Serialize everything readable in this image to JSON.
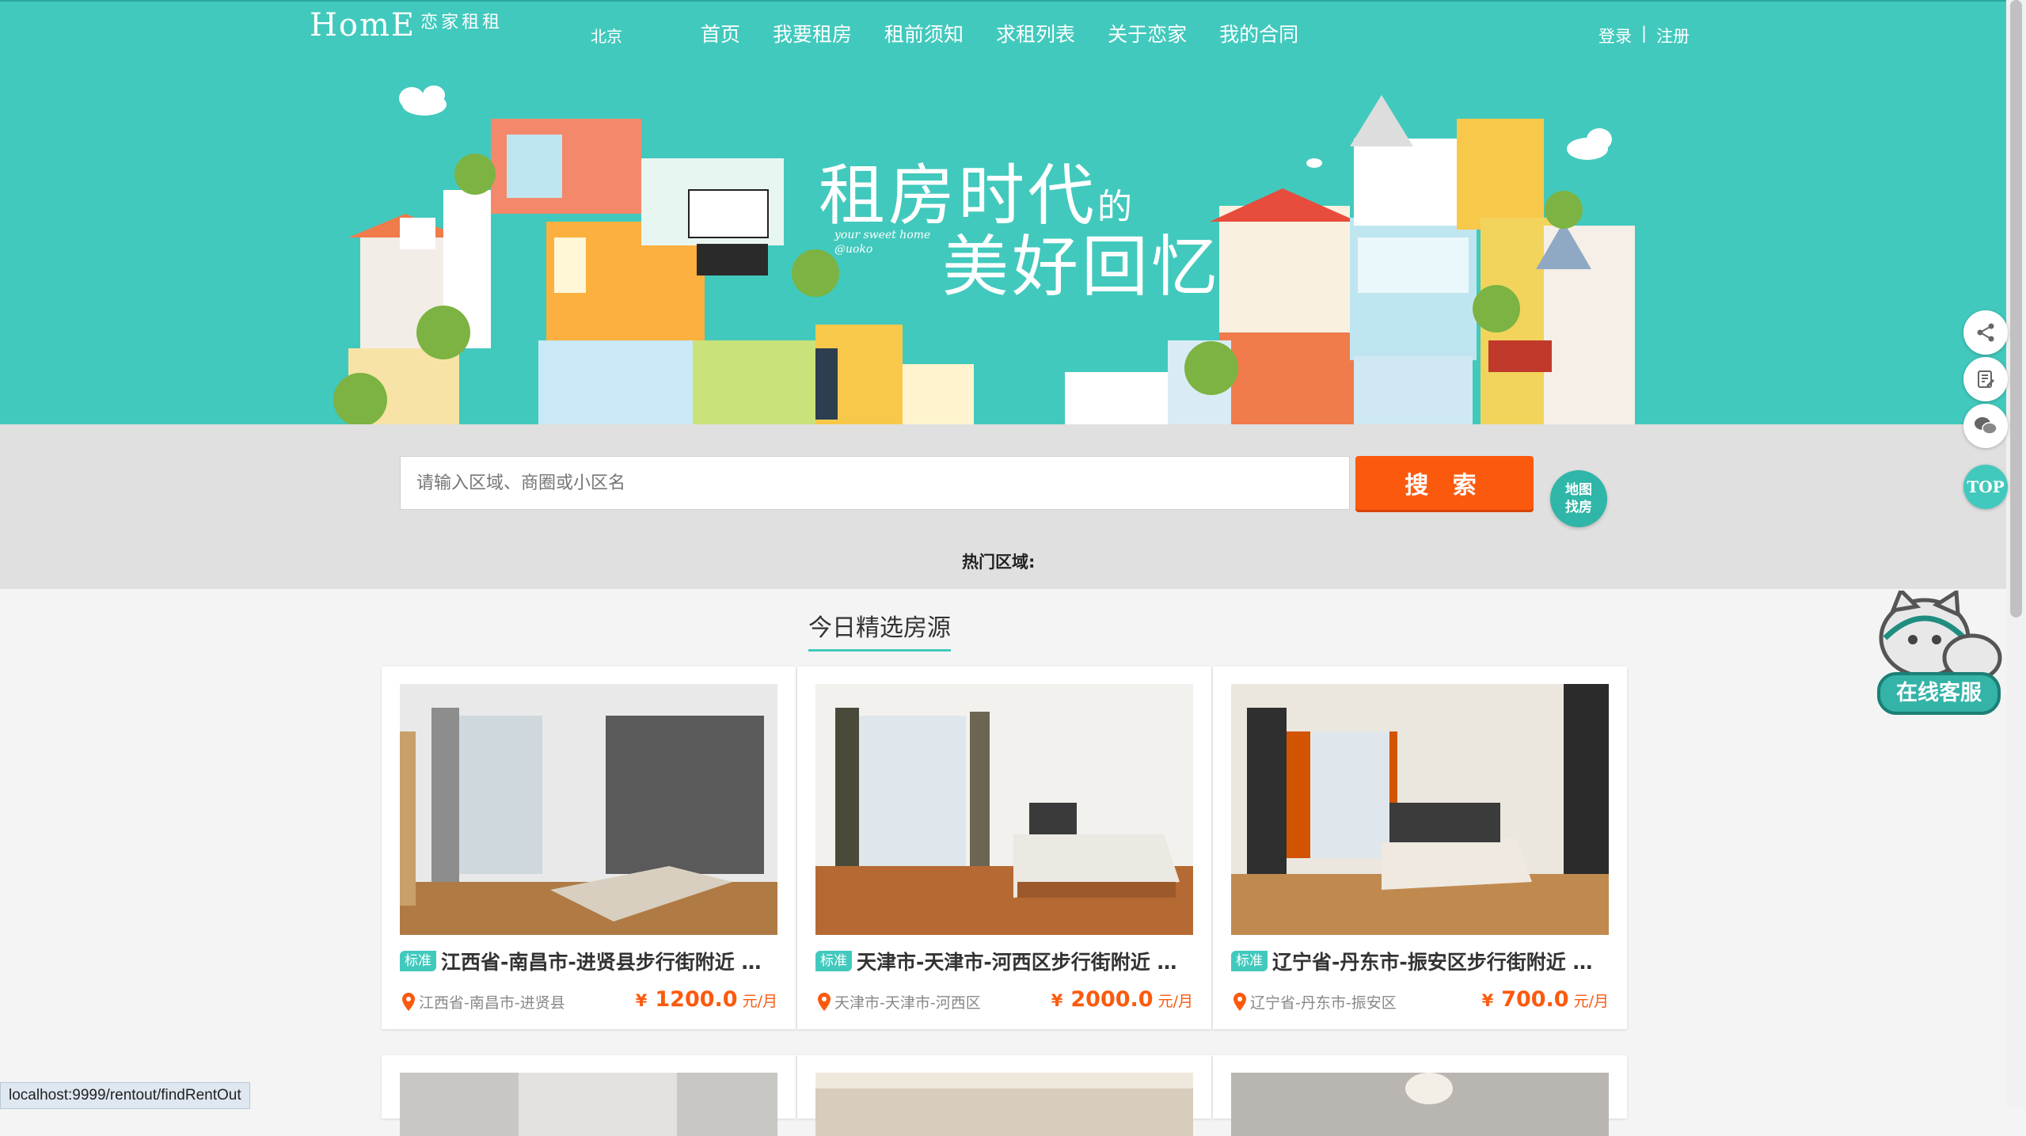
{
  "header": {
    "logo_main": "HomE",
    "logo_sub": "恋家租租",
    "city": "北京",
    "nav": [
      "首页",
      "我要租房",
      "租前须知",
      "求租列表",
      "关于恋家",
      "我的合同"
    ],
    "login": "登录",
    "separator": "|",
    "register": "注册"
  },
  "banner": {
    "slogan_line1": "租房时代",
    "slogan_de": "的",
    "slogan_line2": "美好回忆",
    "slogan_en": "your sweet home @uoko"
  },
  "search": {
    "placeholder": "请输入区域、商圈或小区名",
    "button": "搜 索",
    "map_line1": "地图",
    "map_line2": "找房",
    "hot_areas_label": "热门区域:"
  },
  "section": {
    "title": "今日精选房源"
  },
  "listings": [
    {
      "tag": "标准",
      "title": "江西省-南昌市-进贤县步行街附近 公...",
      "location": "江西省-南昌市-进贤县",
      "currency": "¥",
      "price": "1200.0",
      "unit": "元/月"
    },
    {
      "tag": "标准",
      "title": "天津市-天津市-河西区步行街附近 公...",
      "location": "天津市-天津市-河西区",
      "currency": "¥",
      "price": "2000.0",
      "unit": "元/月"
    },
    {
      "tag": "标准",
      "title": "辽宁省-丹东市-振安区步行街附近 公...",
      "location": "辽宁省-丹东市-振安区",
      "currency": "¥",
      "price": "700.0",
      "unit": "元/月"
    }
  ],
  "sidebar": {
    "icons": [
      "share-icon",
      "edit-icon",
      "wechat-icon"
    ],
    "top_label": "TOP",
    "customer_service": "在线客服"
  },
  "status_bar": {
    "url": "localhost:9999/rentout/findRentOut"
  },
  "colors": {
    "teal": "#42c9bd",
    "orange": "#fb5a0e",
    "search_band": "#e0e0e0"
  }
}
